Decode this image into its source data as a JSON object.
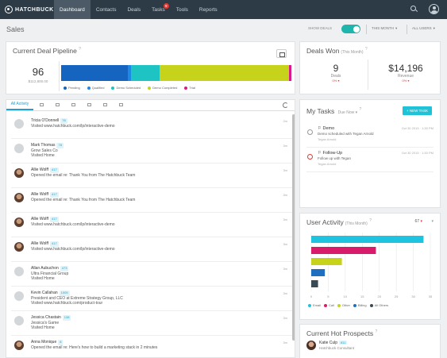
{
  "app": {
    "logo_text": "HATCHBUCK"
  },
  "nav": {
    "items": [
      {
        "label": "Dashboard",
        "active": true
      },
      {
        "label": "Contacts"
      },
      {
        "label": "Deals"
      },
      {
        "label": "Tasks",
        "badge": "9"
      },
      {
        "label": "Tools"
      },
      {
        "label": "Reports"
      }
    ]
  },
  "subheader": {
    "title": "Sales",
    "show_deals_label": "SHOW DEALS",
    "show_deals_on": true,
    "period": "THIS MONTH",
    "users": "ALL USERS"
  },
  "pipeline": {
    "title": "Current Deal Pipeline",
    "count": "96",
    "amount": "$112,800.00",
    "segments": [
      {
        "name": "Pending",
        "value": 80,
        "color": "#1565c0"
      },
      {
        "name": "Qualified",
        "value": 4,
        "color": "#1e88e5"
      },
      {
        "name": "Demo Scheduled",
        "value": 34,
        "color": "#1ec3c3"
      },
      {
        "name": "Demo Completed",
        "value": 155,
        "color": "#c6d31a"
      },
      {
        "name": "Trial",
        "value": 3,
        "color": "#d81b8c"
      }
    ]
  },
  "deals_won": {
    "title": "Deals Won",
    "period": "(This Month)",
    "deals_value": "9",
    "deals_label": "Deals",
    "deals_trend": "0%",
    "revenue_value": "$14,196",
    "revenue_label": "Revenue",
    "revenue_trend": "0%"
  },
  "activity": {
    "tabs": [
      {
        "label": "All Activity",
        "active": true
      },
      {
        "icon": "email-icon"
      },
      {
        "icon": "list-icon"
      },
      {
        "icon": "chat-icon"
      },
      {
        "icon": "phone-icon"
      },
      {
        "icon": "calendar-icon"
      },
      {
        "icon": "flag-icon"
      }
    ],
    "items": [
      {
        "name": "Tricia O'Donnell",
        "score": "78",
        "line2": "Visited www.hatchbuck.com/lp/interactive-demo",
        "line3": "",
        "time": "2m",
        "avatar": "gray"
      },
      {
        "name": "Mark Thomas",
        "score": "78",
        "line2": "Grow Sales Co",
        "line3": "Visited Home",
        "time": "3m",
        "avatar": "gray"
      },
      {
        "name": "Allie Wolff",
        "score": "417",
        "line2": "Opened the email re: Thank You from The Hatchbuck Team",
        "line3": "",
        "time": "3m",
        "avatar": "photo"
      },
      {
        "name": "Allie Wolff",
        "score": "417",
        "line2": "Opened the email re: Thank You from The Hatchbuck Team",
        "line3": "",
        "time": "3m",
        "avatar": "photo"
      },
      {
        "name": "Allie Wolff",
        "score": "417",
        "line2": "Visited www.hatchbuck.com/lp/interactive-demo",
        "line3": "",
        "time": "3m",
        "avatar": "photo"
      },
      {
        "name": "Allie Wolff",
        "score": "417",
        "line2": "Visited www.hatchbuck.com/lp/interactive-demo",
        "line3": "",
        "time": "3m",
        "avatar": "photo"
      },
      {
        "name": "Allan Aubuchon",
        "score": "473",
        "line2": "Ultra Financial Group",
        "line3": "Visited Home",
        "time": "3m",
        "avatar": "gray"
      },
      {
        "name": "Kevin Callahan",
        "score": "1005",
        "line2": "President and CEO at Extreme Strategy Group, LLC",
        "line3": "Visited www.hatchbuck.com/product-tour",
        "time": "3m",
        "avatar": "gray"
      },
      {
        "name": "Jessica Chastain",
        "score": "138",
        "line2": "Jessica's Game",
        "line3": "Visited Home",
        "time": "3m",
        "avatar": "gray"
      },
      {
        "name": "Anna Monique",
        "score": "8",
        "line2": "Opened the email re: Here's how to build a marketing stack in 2 minutes",
        "line3": "",
        "time": "3m",
        "avatar": "photo"
      }
    ]
  },
  "tasks": {
    "title": "My Tasks",
    "filter": "Due Now",
    "new_task_label": "+ NEW TASK",
    "items": [
      {
        "title": "Demo",
        "desc": "Demo scheduled with Tegan Arnold",
        "owner": "Tegan Arnold",
        "date": "Oct 30 2015 · 1:30 PM",
        "overdue": false
      },
      {
        "title": "Follow-Up",
        "desc": "Follow up with Tegan",
        "owner": "Tegan Arnold",
        "date": "Oct 30 2015 · 1:30 PM",
        "overdue": true
      }
    ]
  },
  "user_activity": {
    "title": "User Activity",
    "period": "(This Month)",
    "count": "67",
    "chart_data": {
      "type": "bar",
      "orientation": "horizontal",
      "categories": [
        "Email",
        "Call",
        "Other",
        "Billing",
        "All Others"
      ],
      "values": [
        33,
        19,
        9,
        4,
        2
      ],
      "colors": [
        "#1ec3e0",
        "#d81b6a",
        "#c6d31a",
        "#1e6fbf",
        "#3a4a55"
      ],
      "xlim": [
        0,
        35
      ],
      "ticks": [
        0,
        5,
        10,
        15,
        20,
        25,
        30,
        35
      ],
      "grid": true,
      "legend": "bottom"
    }
  },
  "prospects": {
    "title": "Current Hot Prospects",
    "name": "Katie Culp",
    "score": "811",
    "job": "Hatchbuck Consultant"
  }
}
